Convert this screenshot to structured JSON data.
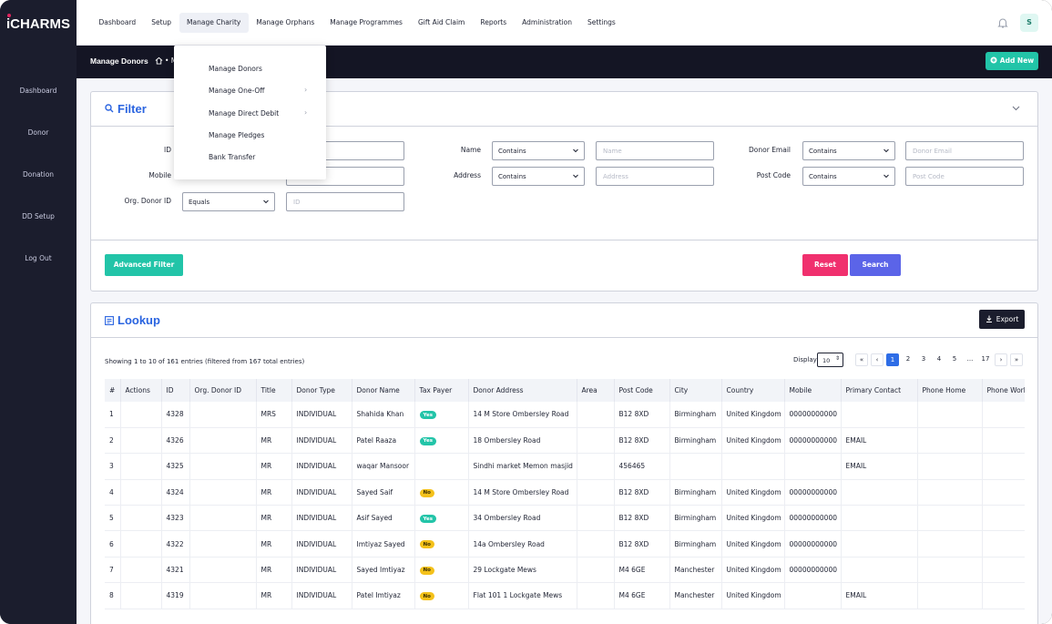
{
  "app": {
    "logo": "iCHARMS"
  },
  "sidebar": {
    "items": [
      {
        "label": "Dashboard",
        "icon": "home-icon"
      },
      {
        "label": "Donor",
        "icon": "user-icon"
      },
      {
        "label": "Donation",
        "icon": "donation-icon"
      },
      {
        "label": "DD Setup",
        "icon": "layers-icon"
      },
      {
        "label": "Log Out",
        "icon": "logout-icon"
      }
    ]
  },
  "topnav": {
    "items": [
      "Dashboard",
      "Setup",
      "Manage Charity",
      "Manage Orphans",
      "Manage Programmes",
      "Gift Aid Claim",
      "Reports",
      "Administration",
      "Settings"
    ],
    "active": "Manage Charity",
    "avatar": "S"
  },
  "dropdown": {
    "items": [
      {
        "label": "Manage Donors",
        "icon": "user-icon",
        "has_submenu": false
      },
      {
        "label": "Manage One-Off",
        "icon": "donation-icon",
        "has_submenu": true
      },
      {
        "label": "Manage Direct Debit",
        "icon": "tag-icon",
        "has_submenu": true
      },
      {
        "label": "Manage Pledges",
        "icon": "document-icon",
        "has_submenu": false
      },
      {
        "label": "Bank Transfer",
        "icon": "circle-icon",
        "has_submenu": false
      }
    ]
  },
  "subbar": {
    "title": "Manage Donors",
    "breadcrumb": "• M",
    "add_new": "Add New"
  },
  "filter": {
    "title": "Filter",
    "fields": {
      "id_label": "ID",
      "mobile_label": "Mobile",
      "org_donor_label": "Org. Donor ID",
      "org_donor_op": "Equals",
      "org_donor_placeholder": "ID",
      "name_label": "Name",
      "name_op": "Contains",
      "name_placeholder": "Name",
      "address_label": "Address",
      "address_op": "Contains",
      "address_placeholder": "Address",
      "email_label": "Donor Email",
      "email_op": "Contains",
      "email_placeholder": "Donor Email",
      "postcode_label": "Post Code",
      "postcode_op": "Contains",
      "postcode_placeholder": "Post Code"
    },
    "advanced_filter": "Advanced Filter",
    "reset": "Reset",
    "search": "Search"
  },
  "lookup": {
    "title": "Lookup",
    "export": "Export",
    "showing": "Showing 1 to 10 of 161 entries (filtered from 167 total entries)",
    "display_label": "Display",
    "display_value": "10",
    "pagination": [
      "1",
      "2",
      "3",
      "4",
      "5",
      "...",
      "17"
    ],
    "columns": [
      "#",
      "Actions",
      "ID",
      "Org. Donor ID",
      "Title",
      "Donor Type",
      "Donor Name",
      "Tax Payer",
      "Donor Address",
      "Area",
      "Post Code",
      "City",
      "Country",
      "Mobile",
      "Primary Contact",
      "Phone Home",
      "Phone Work"
    ],
    "rows": [
      {
        "n": "1",
        "id": "4328",
        "org": "",
        "title": "MRS",
        "type": "INDIVIDUAL",
        "name": "Shahida Khan",
        "tax": "Yes",
        "address": "14 M Store Ombersley Road",
        "area": "",
        "postcode": "B12 8XD",
        "city": "Birmingham",
        "country": "United Kingdom",
        "mobile": "00000000000",
        "contact": "",
        "home": "",
        "work": ""
      },
      {
        "n": "2",
        "id": "4326",
        "org": "",
        "title": "MR",
        "type": "INDIVIDUAL",
        "name": "Patel Raaza",
        "tax": "Yes",
        "address": "18 Ombersley Road",
        "area": "",
        "postcode": "B12 8XD",
        "city": "Birmingham",
        "country": "United Kingdom",
        "mobile": "00000000000",
        "contact": "EMAIL",
        "home": "",
        "work": ""
      },
      {
        "n": "3",
        "id": "4325",
        "org": "",
        "title": "MR",
        "type": "INDIVIDUAL",
        "name": "waqar Mansoor",
        "tax": "",
        "address": "Sindhi market Memon masjid",
        "area": "",
        "postcode": "456465",
        "city": "",
        "country": "",
        "mobile": "",
        "contact": "EMAIL",
        "home": "",
        "work": ""
      },
      {
        "n": "4",
        "id": "4324",
        "org": "",
        "title": "MR",
        "type": "INDIVIDUAL",
        "name": "Sayed Saif",
        "tax": "No",
        "address": "14 M Store Ombersley Road",
        "area": "",
        "postcode": "B12 8XD",
        "city": "Birmingham",
        "country": "United Kingdom",
        "mobile": "00000000000",
        "contact": "",
        "home": "",
        "work": ""
      },
      {
        "n": "5",
        "id": "4323",
        "org": "",
        "title": "MR",
        "type": "INDIVIDUAL",
        "name": "Asif Sayed",
        "tax": "Yes",
        "address": "34 Ombersley Road",
        "area": "",
        "postcode": "B12 8XD",
        "city": "Birmingham",
        "country": "United Kingdom",
        "mobile": "00000000000",
        "contact": "",
        "home": "",
        "work": ""
      },
      {
        "n": "6",
        "id": "4322",
        "org": "",
        "title": "MR",
        "type": "INDIVIDUAL",
        "name": "Imtiyaz Sayed",
        "tax": "No",
        "address": "14a Ombersley Road",
        "area": "",
        "postcode": "B12 8XD",
        "city": "Birmingham",
        "country": "United Kingdom",
        "mobile": "00000000000",
        "contact": "",
        "home": "",
        "work": ""
      },
      {
        "n": "7",
        "id": "4321",
        "org": "",
        "title": "MR",
        "type": "INDIVIDUAL",
        "name": "Sayed Imtiyaz",
        "tax": "No",
        "address": "29 Lockgate Mews",
        "area": "",
        "postcode": "M4 6GE",
        "city": "Manchester",
        "country": "United Kingdom",
        "mobile": "00000000000",
        "contact": "",
        "home": "",
        "work": ""
      },
      {
        "n": "8",
        "id": "4319",
        "org": "",
        "title": "MR",
        "type": "INDIVIDUAL",
        "name": "Patel Imtiyaz",
        "tax": "No",
        "address": "Flat 101 1 Lockgate Mews",
        "area": "",
        "postcode": "M4 6GE",
        "city": "Manchester",
        "country": "United Kingdom",
        "mobile": "",
        "contact": "EMAIL",
        "home": "",
        "work": ""
      }
    ]
  },
  "colors": {
    "accent": "#22c4a8",
    "primary": "#2e6de6",
    "danger": "#f0306e",
    "sidebar": "#1b1d2d",
    "title_blue": "#2a64e0"
  }
}
